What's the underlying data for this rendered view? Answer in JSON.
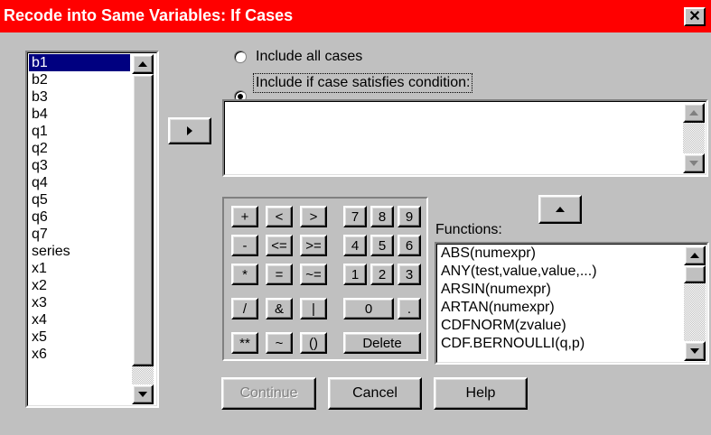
{
  "window": {
    "title": "Recode into Same Variables: If Cases",
    "close_glyph": "✕"
  },
  "variables": [
    "b1",
    "b2",
    "b3",
    "b4",
    "q1",
    "q2",
    "q3",
    "q4",
    "q5",
    "q6",
    "q7",
    "series",
    "x1",
    "x2",
    "x3",
    "x4",
    "x5",
    "x6"
  ],
  "radios": {
    "all_cases": "Include all cases",
    "all_cases_mnemonic": "a",
    "if_condition": "Include if case satisfies condition:",
    "selected": "if_condition"
  },
  "keypad": {
    "operators": [
      [
        "+",
        "<",
        ">"
      ],
      [
        "-",
        "<=",
        ">="
      ],
      [
        "*",
        "=",
        "~="
      ],
      [
        "/",
        "&",
        "|"
      ],
      [
        "**",
        "~",
        "()"
      ]
    ],
    "digits": [
      [
        "7",
        "8",
        "9"
      ],
      [
        "4",
        "5",
        "6"
      ],
      [
        "1",
        "2",
        "3"
      ]
    ],
    "zero": "0",
    "decimal": ".",
    "delete": "Delete"
  },
  "functions": {
    "label": "Functions:",
    "items": [
      "ABS(numexpr)",
      "ANY(test,value,value,...)",
      "ARSIN(numexpr)",
      "ARTAN(numexpr)",
      "CDFNORM(zvalue)",
      "CDF.BERNOULLI(q,p)"
    ]
  },
  "buttons": {
    "continue": "Continue",
    "cancel": "Cancel",
    "help": "Help"
  },
  "colors": {
    "titlebar": "#ff0000",
    "selection": "#000080",
    "face": "#c0c0c0"
  }
}
